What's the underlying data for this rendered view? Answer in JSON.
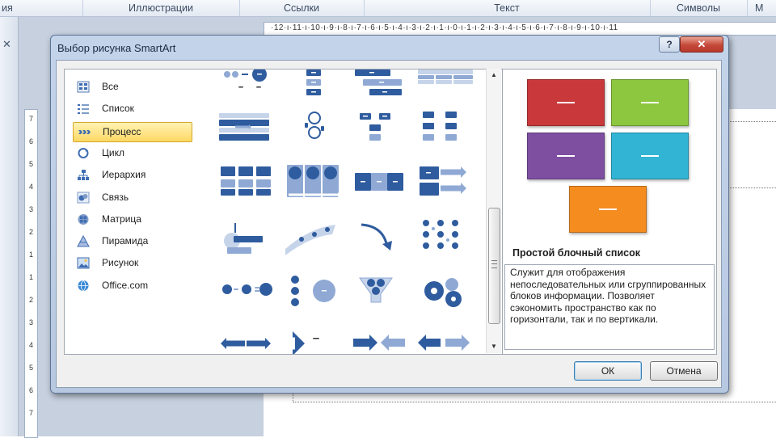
{
  "ribbon": {
    "groups": [
      "ия",
      "Иллюстрации",
      "Ссылки",
      "Текст",
      "Символы",
      "М"
    ]
  },
  "ruler": {
    "horizontal": "·12·ı·11·ı·10·ı·9·ı·8·ı·7·ı·6·ı·5·ı·4·ı·3·ı·2·ı·1·ı·0·ı·1·ı·2·ı·3·ı·4·ı·5·ı·6·ı·7·ı·8·ı·9·ı·10·ı·11",
    "vertical": [
      "7",
      "6",
      "5",
      "4",
      "3",
      "2",
      "1",
      "1",
      "2",
      "3",
      "4",
      "5",
      "6",
      "7"
    ]
  },
  "dialog": {
    "title": "Выбор рисунка SmartArt",
    "help_label": "?",
    "close_label": "✕",
    "ok_label": "ОК",
    "cancel_label": "Отмена"
  },
  "categories": [
    {
      "label": "Все",
      "icon": "all-icon",
      "selected": false
    },
    {
      "label": "Список",
      "icon": "list-icon",
      "selected": false
    },
    {
      "label": "Процесс",
      "icon": "process-icon",
      "selected": true
    },
    {
      "label": "Цикл",
      "icon": "cycle-icon",
      "selected": false
    },
    {
      "label": "Иерархия",
      "icon": "hierarchy-icon",
      "selected": false
    },
    {
      "label": "Связь",
      "icon": "relationship-icon",
      "selected": false
    },
    {
      "label": "Матрица",
      "icon": "matrix-icon",
      "selected": false
    },
    {
      "label": "Пирамида",
      "icon": "pyramid-icon",
      "selected": false
    },
    {
      "label": "Рисунок",
      "icon": "picture-icon",
      "selected": false
    },
    {
      "label": "Office.com",
      "icon": "office-com-icon",
      "selected": false
    }
  ],
  "layouts": [
    {
      "name": "circle-arrow-process-thumb"
    },
    {
      "name": "vertical-process-thumb"
    },
    {
      "name": "staggered-process-thumb"
    },
    {
      "name": "table-list-thumb"
    },
    {
      "name": "segmented-process-thumb"
    },
    {
      "name": "circle-chain-thumb"
    },
    {
      "name": "bending-process-thumb"
    },
    {
      "name": "repeating-bending-thumb"
    },
    {
      "name": "detailed-process-thumb"
    },
    {
      "name": "column-process-thumb"
    },
    {
      "name": "basic-chevron-thumb"
    },
    {
      "name": "accent-process-thumb"
    },
    {
      "name": "upward-step-thumb"
    },
    {
      "name": "up-arrow-thumb"
    },
    {
      "name": "curved-arrow-thumb"
    },
    {
      "name": "circle-dot-grid-thumb"
    },
    {
      "name": "equation-thumb"
    },
    {
      "name": "vertical-equation-thumb"
    },
    {
      "name": "funnel-thumb"
    },
    {
      "name": "gear-thumb"
    },
    {
      "name": "opposing-arrows-thumb"
    },
    {
      "name": "up-arrow-steps-thumb"
    },
    {
      "name": "converging-arrows-thumb"
    },
    {
      "name": "opposing-double-arrows-thumb"
    }
  ],
  "preview": {
    "title": "Простой блочный список",
    "description": "Служит для отображения непоследовательных или сгруппированных блоков информации. Позволяет сэкономить пространство как по горизонтали, так и по вертикали.",
    "block_colors": [
      "#c9393b",
      "#8dc63f",
      "#7e4fa1",
      "#32b4d4",
      "#f48c20"
    ],
    "block_text": "—"
  },
  "colors": {
    "selection": "#ffd864",
    "smartart_blue": "#2f5c9e"
  }
}
